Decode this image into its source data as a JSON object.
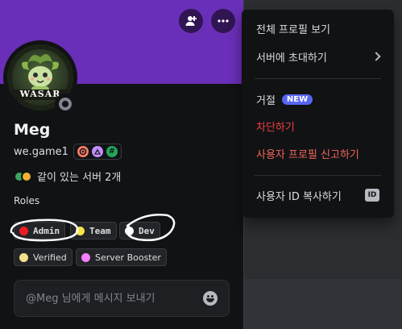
{
  "profile": {
    "display_name": "Meg",
    "username": "we.game1",
    "mutual_servers": "같이 있는 서버 2개",
    "roles_label": "Roles",
    "avatar_text": "WASAR",
    "banner_color": "#6a2fb8",
    "status": "offline"
  },
  "badges": [
    {
      "icon": "hypesquad-icon",
      "glyph": "⬢",
      "color": "#f47b67"
    },
    {
      "icon": "active-developer-icon",
      "glyph": "▲",
      "color": "#c18eff"
    },
    {
      "icon": "hashtag-icon",
      "glyph": "#",
      "color": "#23a55a"
    }
  ],
  "roles": [
    {
      "label": "Admin",
      "color": "#ed1c24"
    },
    {
      "label": "Team",
      "color": "#f5e547"
    },
    {
      "label": "Dev",
      "color": "#ffffff"
    },
    {
      "label": "Verified",
      "color": "#f3e08a"
    },
    {
      "label": "Server Booster",
      "color": "#f47fff"
    }
  ],
  "message": {
    "placeholder": "@Meg 님에게 메시지 보내기"
  },
  "menu": {
    "view_full_profile": "전체 프로필 보기",
    "invite_to_server": "서버에 초대하기",
    "ignore": "거절",
    "new_badge": "NEW",
    "block": "차단하기",
    "report_profile": "사용자 프로필 신고하기",
    "copy_user_id": "사용자 ID 복사하기",
    "id_icon_text": "ID"
  }
}
